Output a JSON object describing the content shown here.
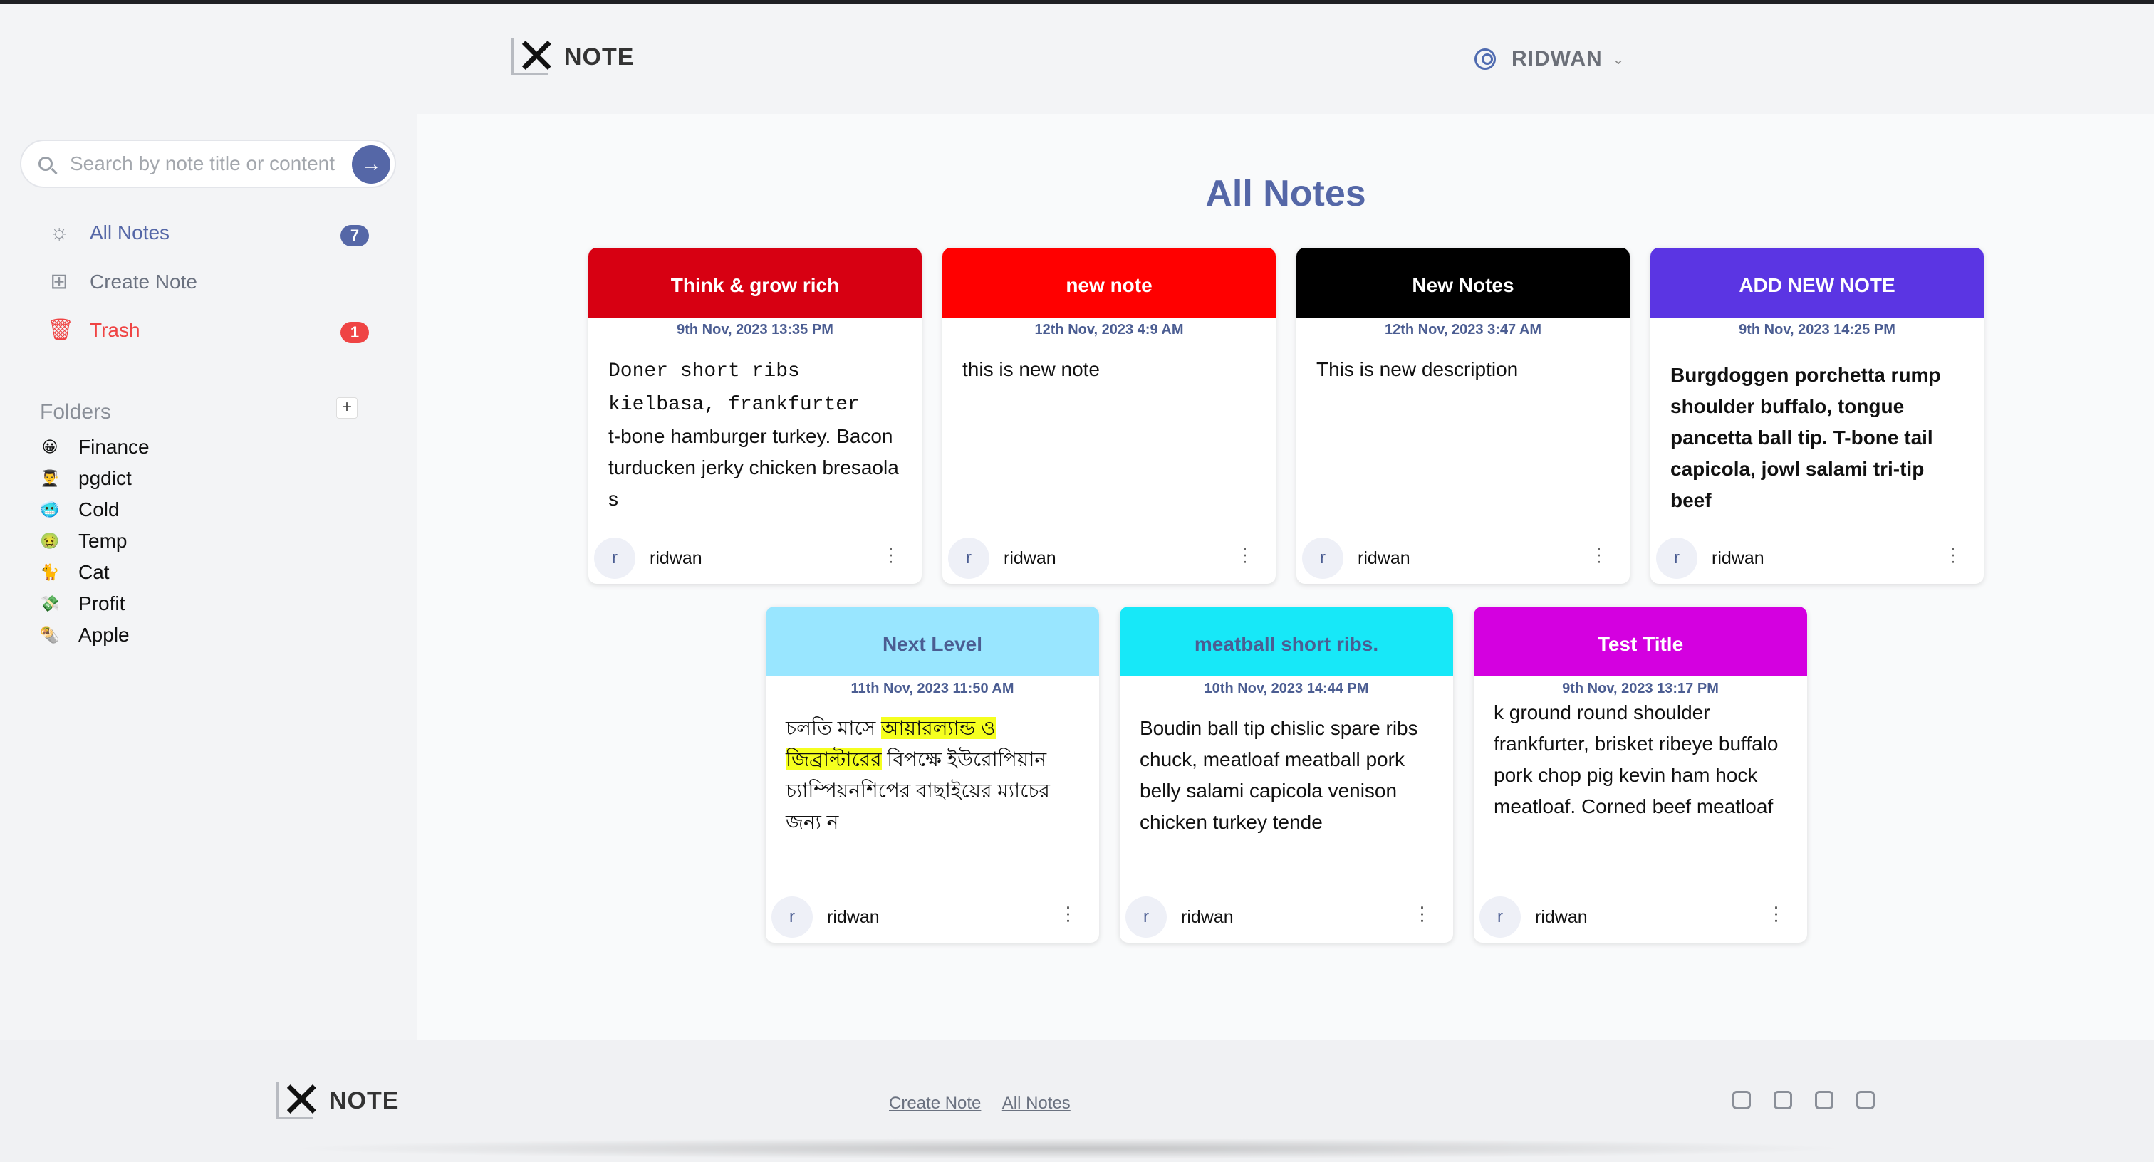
{
  "app": {
    "name": "NOTE"
  },
  "user": {
    "name": "RIDWAN"
  },
  "search": {
    "placeholder": "Search by note title or content"
  },
  "nav": {
    "all_notes": "All Notes",
    "all_notes_count": "7",
    "create_note": "Create Note",
    "trash": "Trash",
    "trash_count": "1"
  },
  "folders": {
    "title": "Folders",
    "items": [
      {
        "name": "Finance",
        "icon": "😀"
      },
      {
        "name": "pgdict",
        "icon": "👨‍🎓"
      },
      {
        "name": "Cold",
        "icon": "🥶"
      },
      {
        "name": "Temp",
        "icon": "🤢"
      },
      {
        "name": "Cat",
        "icon": "🐈"
      },
      {
        "name": "Profit",
        "icon": "💸"
      },
      {
        "name": "Apple",
        "icon": "🌯"
      }
    ]
  },
  "main": {
    "title": "All Notes"
  },
  "notes": [
    {
      "title": "Think & grow rich",
      "color": "#d70012",
      "title_color": "#ffffff",
      "date": "9th Nov, 2023 13:35 PM",
      "line1": "Doner short ribs",
      "line2": "kielbasa, frankfurter",
      "line3": "t-bone hamburger turkey. Bacon turducken jerky chicken bresaola s",
      "author": "ridwan",
      "avatar": "r"
    },
    {
      "title": "new note",
      "color": "#ff0000",
      "title_color": "#ffffff",
      "date": "12th Nov, 2023 4:9 AM",
      "body": "this is new note",
      "author": "ridwan",
      "avatar": "r"
    },
    {
      "title": "New Notes",
      "color": "#000000",
      "title_color": "#ffffff",
      "date": "12th Nov, 2023 3:47 AM",
      "body": "This is new description",
      "author": "ridwan",
      "avatar": "r"
    },
    {
      "title": "ADD NEW NOTE",
      "color": "#5b35e3",
      "title_color": "#ffffff",
      "date": "9th Nov, 2023 14:25 PM",
      "body": "Burgdoggen porchetta rump shoulder buffalo, tongue pancetta ball tip. T-bone tail capicola, jowl salami tri-tip beef",
      "author": "ridwan",
      "avatar": "r"
    },
    {
      "title": "Next Level",
      "color": "#99e6ff",
      "title_color": "#4b5d92",
      "date": "11th Nov, 2023 11:50 AM",
      "body_a": "চলতি মাসে ",
      "body_hl1": "আয়ারল্যান্ড ও",
      "body_hl2": "জিব্রাল্টারের",
      "body_b": " বিপক্ষে ইউরোপিয়ান চ্যাম্পিয়নশিপের বাছাইয়ের ম্যাচের জন্য ন",
      "author": "ridwan",
      "avatar": "r"
    },
    {
      "title": "meatball short ribs.",
      "color": "#17e8f8",
      "title_color": "#4b5d92",
      "date": "10th Nov, 2023 14:44 PM",
      "body": "Boudin ball tip chislic spare ribs chuck, meatloaf meatball pork belly salami capicola venison chicken turkey tende",
      "author": "ridwan",
      "avatar": "r"
    },
    {
      "title": "Test Title",
      "color": "#d400e0",
      "title_color": "#ffffff",
      "date": "9th Nov, 2023 13:17 PM",
      "body": "k ground round shoulder frankfurter, brisket ribeye buffalo pork chop pig kevin ham hock meatloaf. Corned beef meatloaf",
      "author": "ridwan",
      "avatar": "r"
    }
  ],
  "footer": {
    "name": "NOTE",
    "link_create": "Create Note",
    "link_all": "All Notes"
  }
}
